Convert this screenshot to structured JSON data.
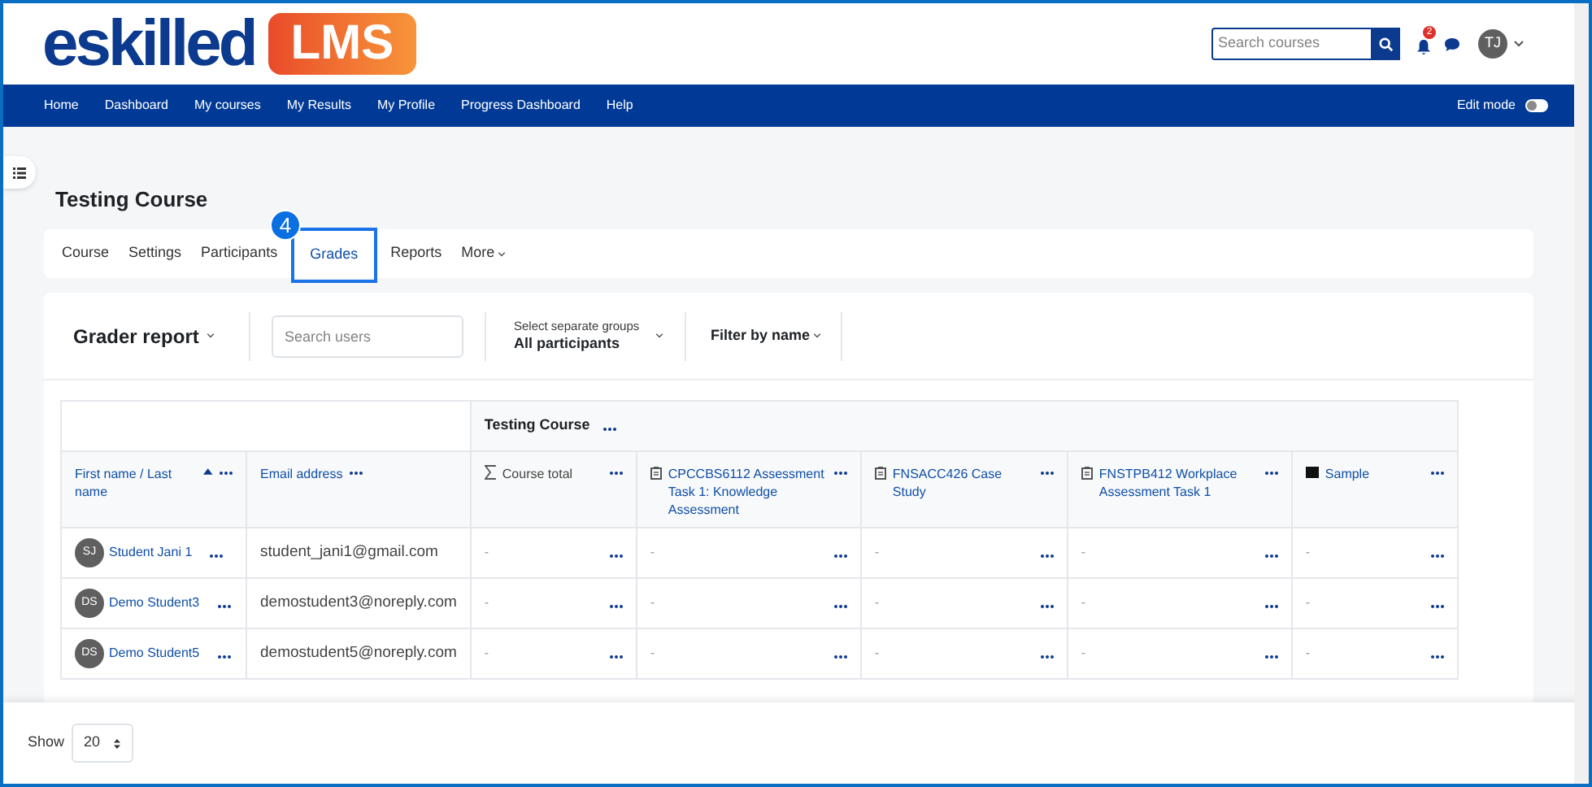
{
  "header": {
    "logo_text": "eskilled",
    "logo_badge": "LMS",
    "search": {
      "placeholder": "Search courses"
    },
    "notification_count": "2",
    "user_initials": "TJ"
  },
  "nav": {
    "items": [
      "Home",
      "Dashboard",
      "My courses",
      "My Results",
      "My Profile",
      "Progress Dashboard",
      "Help"
    ],
    "edit_mode": {
      "label": "Edit mode",
      "on": false
    }
  },
  "course_title": "Testing Course",
  "course_tabs": [
    {
      "label": "Course",
      "selected": false
    },
    {
      "label": "Settings",
      "selected": false
    },
    {
      "label": "Participants",
      "selected": false
    },
    {
      "label": "Grades",
      "selected": true
    },
    {
      "label": "Reports",
      "selected": false
    },
    {
      "label": "More",
      "selected": false
    }
  ],
  "callout": {
    "number": "4"
  },
  "toolbar": {
    "report_label": "Grader report",
    "search": {
      "placeholder": "Search users"
    },
    "groups": {
      "label": "Select separate groups",
      "value": "All participants"
    },
    "filter_label": "Filter by name"
  },
  "table": {
    "category": "Testing Course",
    "columns": [
      {
        "label": "First name / Last name",
        "kind": "name"
      },
      {
        "label": "Email address",
        "kind": "email"
      },
      {
        "label": "Course total",
        "kind": "total"
      },
      {
        "label": "CPCCBS6112 Assessment Task 1: Knowledge Assessment",
        "kind": "assignment"
      },
      {
        "label": "FNSACC426 Case Study",
        "kind": "assignment"
      },
      {
        "label": "FNSTPB412 Workplace Assessment Task 1",
        "kind": "assignment"
      },
      {
        "label": "Sample",
        "kind": "resource"
      }
    ],
    "rows": [
      {
        "initials": "SJ",
        "name": "Student Jani 1",
        "email": "student_jani1@gmail.com",
        "grades": [
          "-",
          "-",
          "-",
          "-",
          "-"
        ]
      },
      {
        "initials": "DS",
        "name": "Demo Student3",
        "email": "demostudent3@noreply.com",
        "grades": [
          "-",
          "-",
          "-",
          "-",
          "-"
        ]
      },
      {
        "initials": "DS",
        "name": "Demo Student5",
        "email": "demostudent5@noreply.com",
        "grades": [
          "-",
          "-",
          "-",
          "-",
          "-"
        ]
      }
    ]
  },
  "footer": {
    "label": "Show",
    "value": "20"
  }
}
